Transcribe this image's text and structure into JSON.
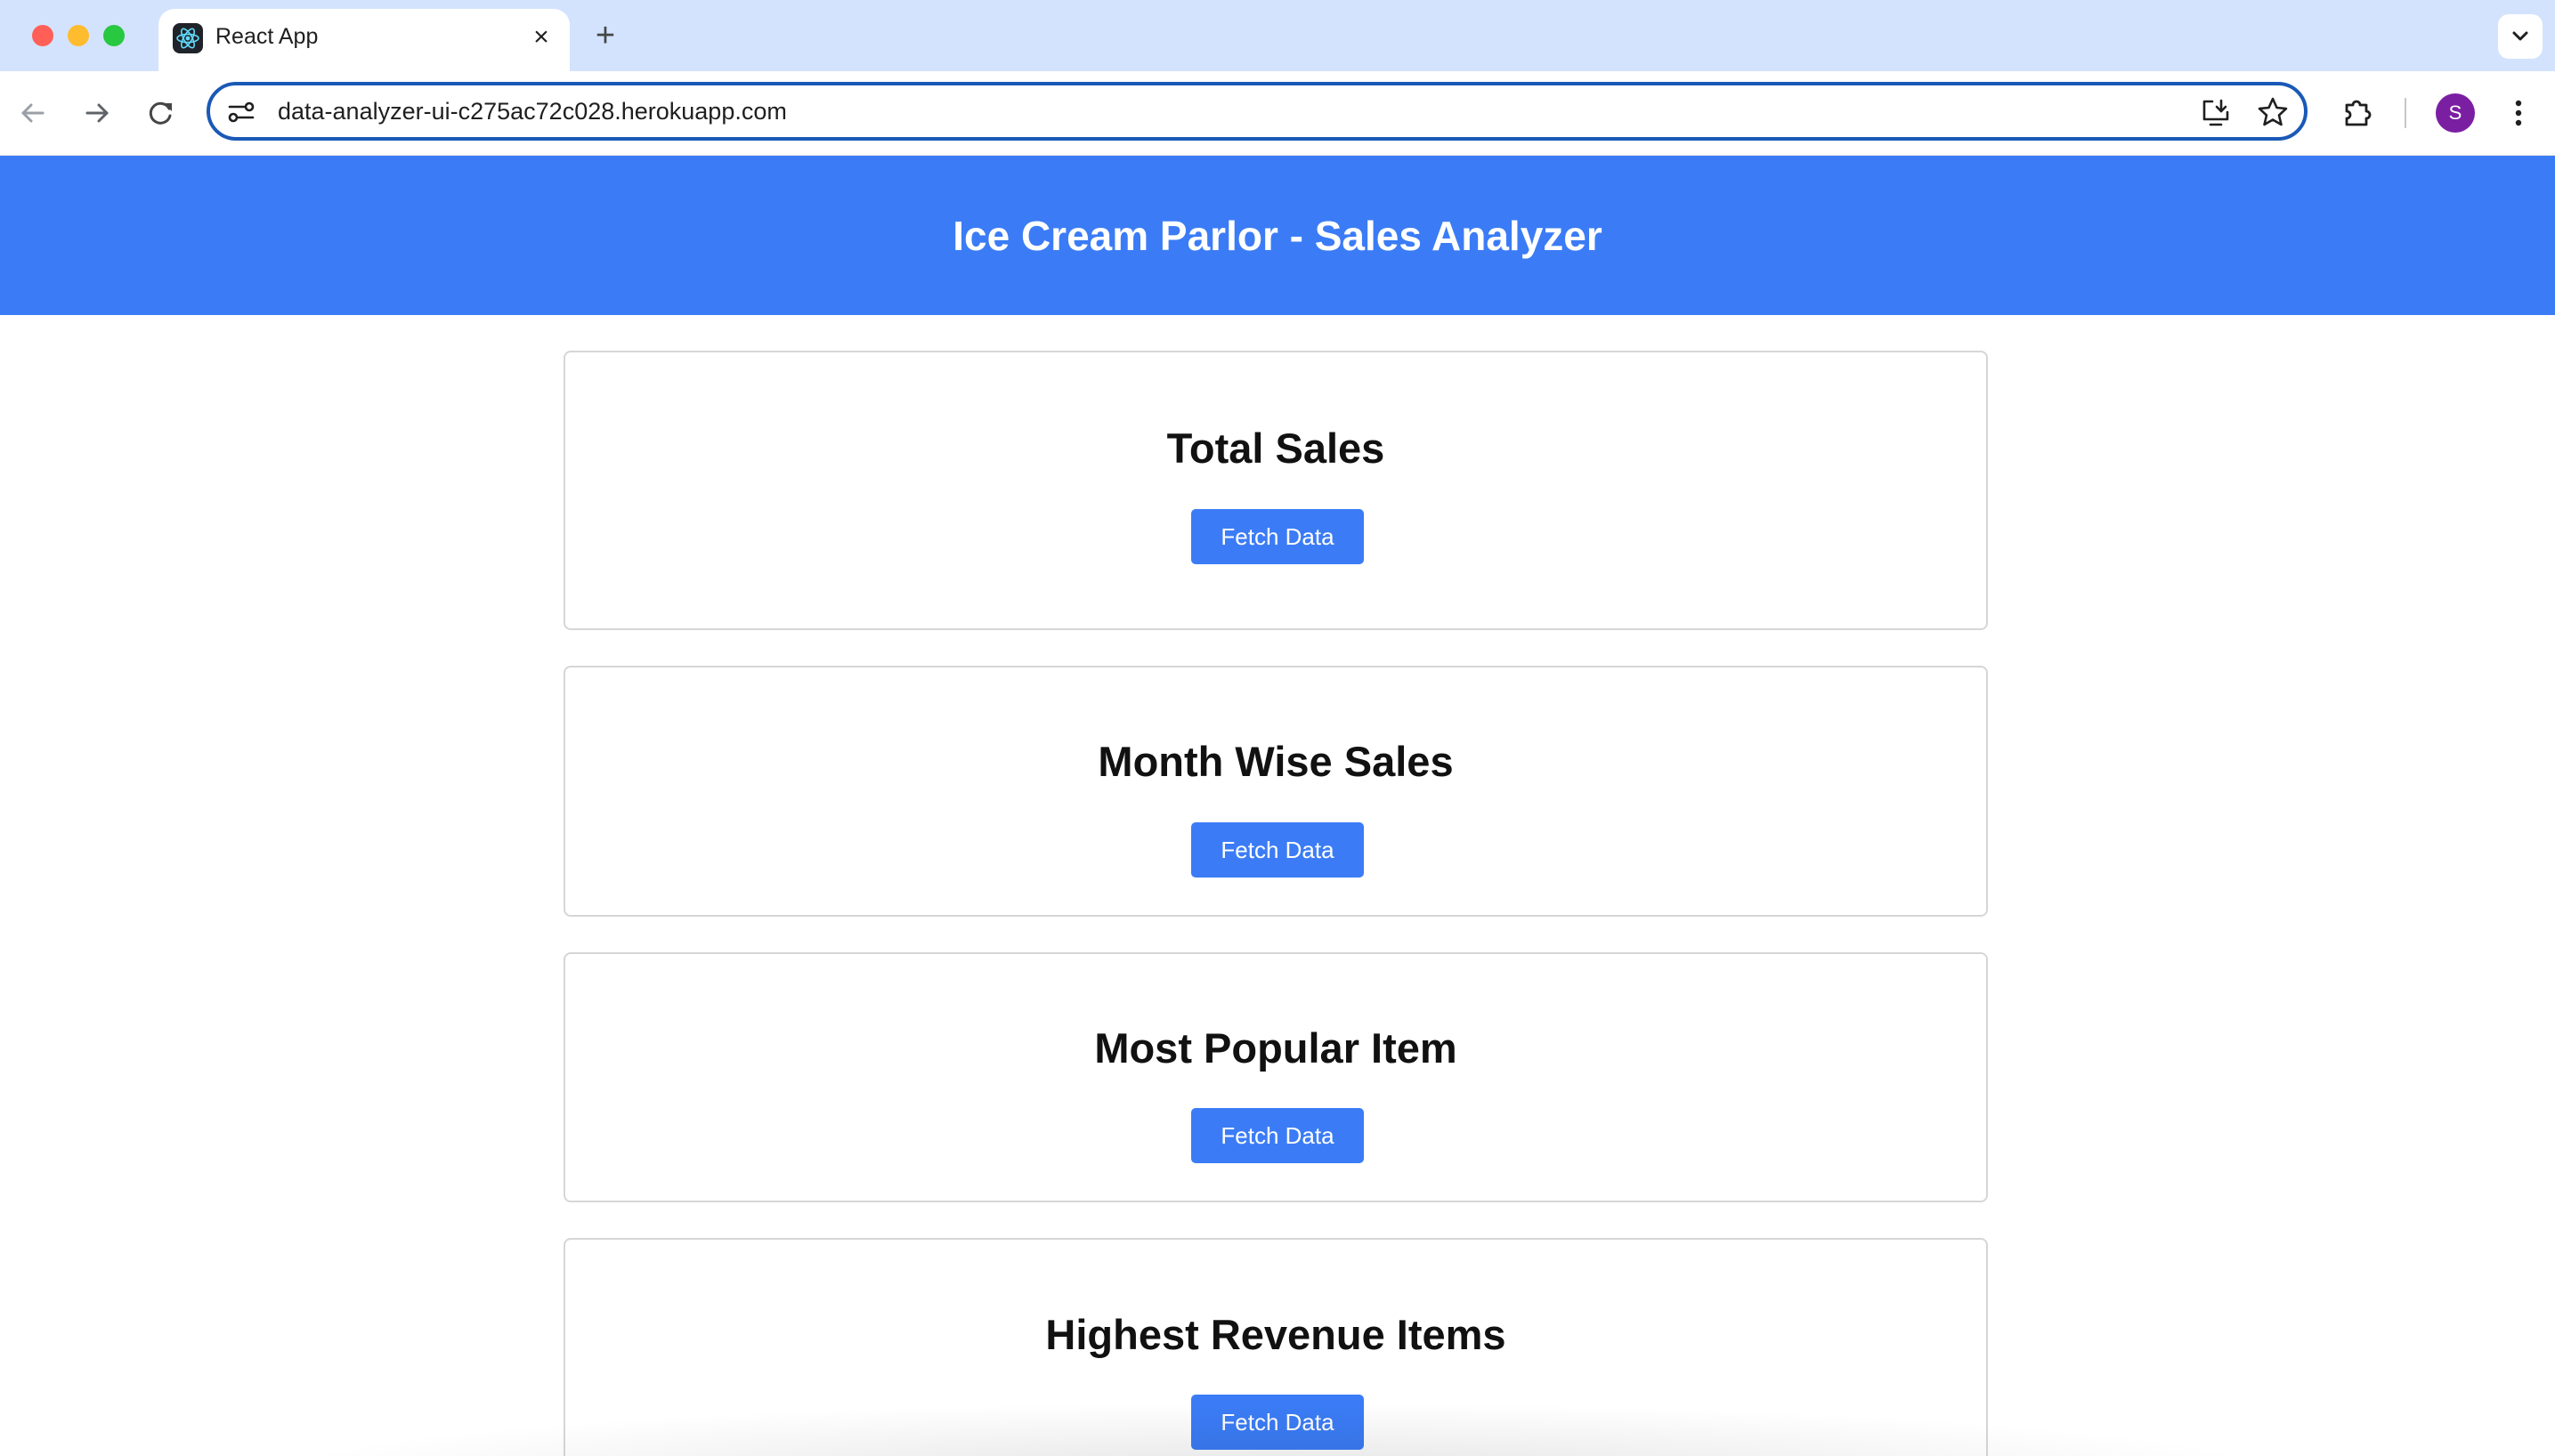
{
  "browser": {
    "tab_title": "React App",
    "tab_close": "×",
    "new_tab": "+",
    "url": "data-analyzer-ui-c275ac72c028.herokuapp.com",
    "profile_initial": "S"
  },
  "app": {
    "title": "Ice Cream Parlor - Sales Analyzer",
    "accent_color": "#3b7cf6"
  },
  "cards": [
    {
      "title": "Total Sales",
      "button": "Fetch Data"
    },
    {
      "title": "Month Wise Sales",
      "button": "Fetch Data"
    },
    {
      "title": "Most Popular Item",
      "button": "Fetch Data"
    },
    {
      "title": "Highest Revenue Items",
      "button": "Fetch Data"
    }
  ],
  "icons": {
    "tab_favicon": "react-logo-icon",
    "back": "arrow-left-icon",
    "forward": "arrow-right-icon",
    "reload": "reload-icon",
    "site_info": "tune-icon",
    "install": "install-app-icon",
    "bookmark": "star-icon",
    "extensions": "puzzle-icon",
    "menu": "more-vert-icon",
    "tab_search": "chevron-down-icon"
  }
}
